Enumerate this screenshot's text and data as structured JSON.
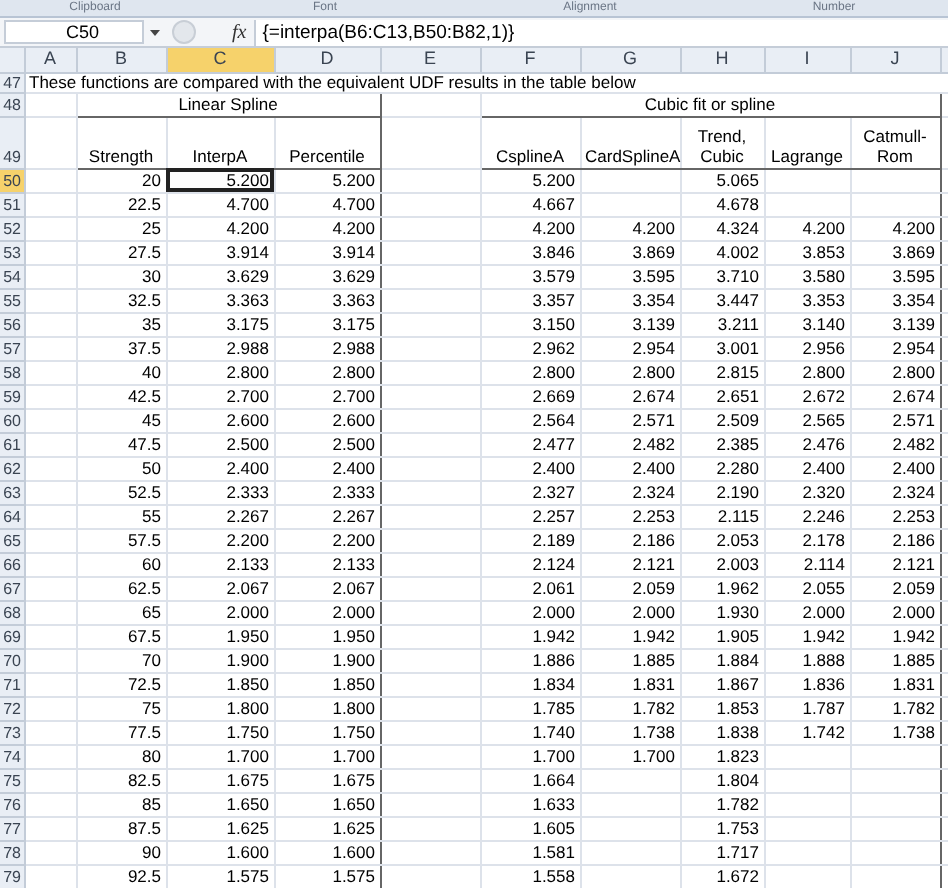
{
  "ribbon_groups": [
    "Clipboard",
    "Font",
    "Alignment",
    "Number"
  ],
  "formula_bar": {
    "name_box": "C50",
    "function_label": "fx",
    "formula": "{=interpa(B6:C13,B50:B82,1)}"
  },
  "columns": [
    {
      "label": "A",
      "selected": false
    },
    {
      "label": "B",
      "selected": false
    },
    {
      "label": "C",
      "selected": true
    },
    {
      "label": "D",
      "selected": false
    },
    {
      "label": "E",
      "selected": false
    },
    {
      "label": "F",
      "selected": false
    },
    {
      "label": "G",
      "selected": false
    },
    {
      "label": "H",
      "selected": false
    },
    {
      "label": "I",
      "selected": false
    },
    {
      "label": "J",
      "selected": false
    }
  ],
  "note_row": {
    "number": "47",
    "text": "These functions are compared with the equivalent UDF results in the table below"
  },
  "group_row": {
    "number": "48",
    "groups": [
      "Linear Spline",
      "Cubic fit or spline"
    ]
  },
  "header_row": {
    "number": "49",
    "cells": [
      "",
      "Strength",
      "InterpA",
      "Percentile",
      "",
      "CsplineA",
      "CardSplineA",
      "Trend, Cubic",
      "Lagrange",
      "Catmull-Rom"
    ]
  },
  "rows": [
    {
      "number": "50",
      "selected": true,
      "cells": [
        "",
        "20",
        "5.200",
        "5.200",
        "",
        "5.200",
        "",
        "5.065",
        "",
        ""
      ]
    },
    {
      "number": "51",
      "selected": false,
      "cells": [
        "",
        "22.5",
        "4.700",
        "4.700",
        "",
        "4.667",
        "",
        "4.678",
        "",
        ""
      ]
    },
    {
      "number": "52",
      "selected": false,
      "cells": [
        "",
        "25",
        "4.200",
        "4.200",
        "",
        "4.200",
        "4.200",
        "4.324",
        "4.200",
        "4.200"
      ]
    },
    {
      "number": "53",
      "selected": false,
      "cells": [
        "",
        "27.5",
        "3.914",
        "3.914",
        "",
        "3.846",
        "3.869",
        "4.002",
        "3.853",
        "3.869"
      ]
    },
    {
      "number": "54",
      "selected": false,
      "cells": [
        "",
        "30",
        "3.629",
        "3.629",
        "",
        "3.579",
        "3.595",
        "3.710",
        "3.580",
        "3.595"
      ]
    },
    {
      "number": "55",
      "selected": false,
      "cells": [
        "",
        "32.5",
        "3.363",
        "3.363",
        "",
        "3.357",
        "3.354",
        "3.447",
        "3.353",
        "3.354"
      ]
    },
    {
      "number": "56",
      "selected": false,
      "cells": [
        "",
        "35",
        "3.175",
        "3.175",
        "",
        "3.150",
        "3.139",
        "3.211",
        "3.140",
        "3.139"
      ]
    },
    {
      "number": "57",
      "selected": false,
      "cells": [
        "",
        "37.5",
        "2.988",
        "2.988",
        "",
        "2.962",
        "2.954",
        "3.001",
        "2.956",
        "2.954"
      ]
    },
    {
      "number": "58",
      "selected": false,
      "cells": [
        "",
        "40",
        "2.800",
        "2.800",
        "",
        "2.800",
        "2.800",
        "2.815",
        "2.800",
        "2.800"
      ]
    },
    {
      "number": "59",
      "selected": false,
      "cells": [
        "",
        "42.5",
        "2.700",
        "2.700",
        "",
        "2.669",
        "2.674",
        "2.651",
        "2.672",
        "2.674"
      ]
    },
    {
      "number": "60",
      "selected": false,
      "cells": [
        "",
        "45",
        "2.600",
        "2.600",
        "",
        "2.564",
        "2.571",
        "2.509",
        "2.565",
        "2.571"
      ]
    },
    {
      "number": "61",
      "selected": false,
      "cells": [
        "",
        "47.5",
        "2.500",
        "2.500",
        "",
        "2.477",
        "2.482",
        "2.385",
        "2.476",
        "2.482"
      ]
    },
    {
      "number": "62",
      "selected": false,
      "cells": [
        "",
        "50",
        "2.400",
        "2.400",
        "",
        "2.400",
        "2.400",
        "2.280",
        "2.400",
        "2.400"
      ]
    },
    {
      "number": "63",
      "selected": false,
      "cells": [
        "",
        "52.5",
        "2.333",
        "2.333",
        "",
        "2.327",
        "2.324",
        "2.190",
        "2.320",
        "2.324"
      ]
    },
    {
      "number": "64",
      "selected": false,
      "cells": [
        "",
        "55",
        "2.267",
        "2.267",
        "",
        "2.257",
        "2.253",
        "2.115",
        "2.246",
        "2.253"
      ]
    },
    {
      "number": "65",
      "selected": false,
      "cells": [
        "",
        "57.5",
        "2.200",
        "2.200",
        "",
        "2.189",
        "2.186",
        "2.053",
        "2.178",
        "2.186"
      ]
    },
    {
      "number": "66",
      "selected": false,
      "cells": [
        "",
        "60",
        "2.133",
        "2.133",
        "",
        "2.124",
        "2.121",
        "2.003",
        "2.114",
        "2.121"
      ]
    },
    {
      "number": "67",
      "selected": false,
      "cells": [
        "",
        "62.5",
        "2.067",
        "2.067",
        "",
        "2.061",
        "2.059",
        "1.962",
        "2.055",
        "2.059"
      ]
    },
    {
      "number": "68",
      "selected": false,
      "cells": [
        "",
        "65",
        "2.000",
        "2.000",
        "",
        "2.000",
        "2.000",
        "1.930",
        "2.000",
        "2.000"
      ]
    },
    {
      "number": "69",
      "selected": false,
      "cells": [
        "",
        "67.5",
        "1.950",
        "1.950",
        "",
        "1.942",
        "1.942",
        "1.905",
        "1.942",
        "1.942"
      ]
    },
    {
      "number": "70",
      "selected": false,
      "cells": [
        "",
        "70",
        "1.900",
        "1.900",
        "",
        "1.886",
        "1.885",
        "1.884",
        "1.888",
        "1.885"
      ]
    },
    {
      "number": "71",
      "selected": false,
      "cells": [
        "",
        "72.5",
        "1.850",
        "1.850",
        "",
        "1.834",
        "1.831",
        "1.867",
        "1.836",
        "1.831"
      ]
    },
    {
      "number": "72",
      "selected": false,
      "cells": [
        "",
        "75",
        "1.800",
        "1.800",
        "",
        "1.785",
        "1.782",
        "1.853",
        "1.787",
        "1.782"
      ]
    },
    {
      "number": "73",
      "selected": false,
      "cells": [
        "",
        "77.5",
        "1.750",
        "1.750",
        "",
        "1.740",
        "1.738",
        "1.838",
        "1.742",
        "1.738"
      ]
    },
    {
      "number": "74",
      "selected": false,
      "cells": [
        "",
        "80",
        "1.700",
        "1.700",
        "",
        "1.700",
        "1.700",
        "1.823",
        "",
        ""
      ]
    },
    {
      "number": "75",
      "selected": false,
      "cells": [
        "",
        "82.5",
        "1.675",
        "1.675",
        "",
        "1.664",
        "",
        "1.804",
        "",
        ""
      ]
    },
    {
      "number": "76",
      "selected": false,
      "cells": [
        "",
        "85",
        "1.650",
        "1.650",
        "",
        "1.633",
        "",
        "1.782",
        "",
        ""
      ]
    },
    {
      "number": "77",
      "selected": false,
      "cells": [
        "",
        "87.5",
        "1.625",
        "1.625",
        "",
        "1.605",
        "",
        "1.753",
        "",
        ""
      ]
    },
    {
      "number": "78",
      "selected": false,
      "cells": [
        "",
        "90",
        "1.600",
        "1.600",
        "",
        "1.581",
        "",
        "1.717",
        "",
        ""
      ]
    },
    {
      "number": "79",
      "selected": false,
      "cells": [
        "",
        "92.5",
        "1.575",
        "1.575",
        "",
        "1.558",
        "",
        "1.672",
        "",
        ""
      ]
    }
  ]
}
